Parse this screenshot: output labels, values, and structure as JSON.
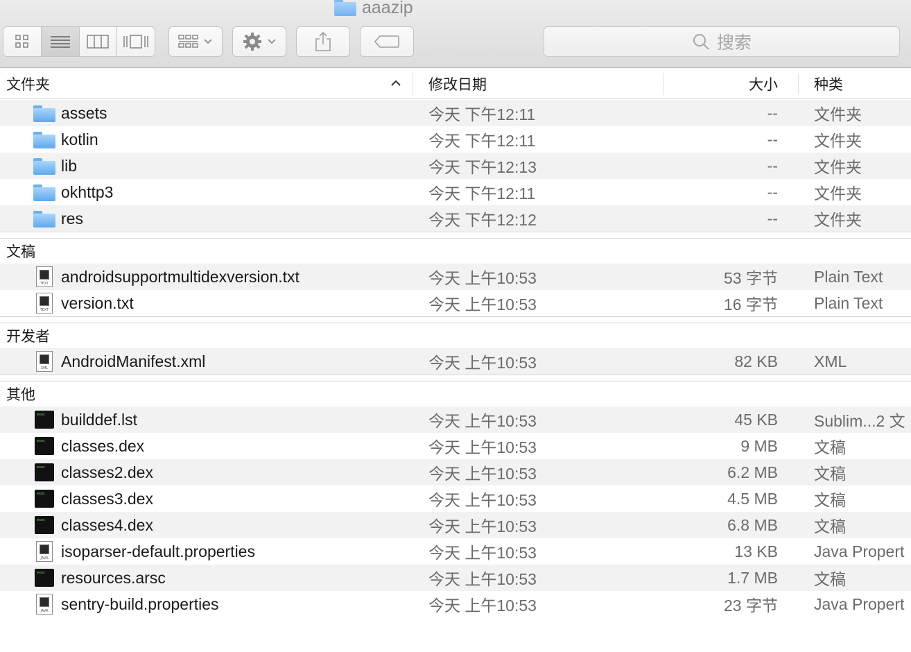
{
  "window": {
    "title": "aaazip"
  },
  "toolbar": {
    "view_buttons": [
      "icon-view",
      "list-view",
      "column-view",
      "cover-flow-view"
    ],
    "search_placeholder": "搜索"
  },
  "columns": {
    "name": "文件夹",
    "date": "修改日期",
    "size": "大小",
    "kind": "种类"
  },
  "folders": [
    {
      "name": "assets",
      "date": "今天 下午12:11",
      "size": "--",
      "kind": "文件夹"
    },
    {
      "name": "kotlin",
      "date": "今天 下午12:11",
      "size": "--",
      "kind": "文件夹"
    },
    {
      "name": "lib",
      "date": "今天 下午12:13",
      "size": "--",
      "kind": "文件夹"
    },
    {
      "name": "okhttp3",
      "date": "今天 下午12:11",
      "size": "--",
      "kind": "文件夹"
    },
    {
      "name": "res",
      "date": "今天 下午12:12",
      "size": "--",
      "kind": "文件夹"
    }
  ],
  "groups": [
    {
      "title": "文稿",
      "items": [
        {
          "name": "androidsupportmultidexversion.txt",
          "date": "今天 上午10:53",
          "size": "53 字节",
          "kind": "Plain Text",
          "icon": "TEXT"
        },
        {
          "name": "version.txt",
          "date": "今天 上午10:53",
          "size": "16 字节",
          "kind": "Plain Text",
          "icon": "TEXT"
        }
      ]
    },
    {
      "title": "开发者",
      "items": [
        {
          "name": "AndroidManifest.xml",
          "date": "今天 上午10:53",
          "size": "82 KB",
          "kind": "XML",
          "icon": "XML"
        }
      ]
    },
    {
      "title": "其他",
      "items": [
        {
          "name": "builddef.lst",
          "date": "今天 上午10:53",
          "size": "45 KB",
          "kind": "Sublim...2 文",
          "icon": "term"
        },
        {
          "name": "classes.dex",
          "date": "今天 上午10:53",
          "size": "9 MB",
          "kind": "文稿",
          "icon": "term"
        },
        {
          "name": "classes2.dex",
          "date": "今天 上午10:53",
          "size": "6.2 MB",
          "kind": "文稿",
          "icon": "term"
        },
        {
          "name": "classes3.dex",
          "date": "今天 上午10:53",
          "size": "4.5 MB",
          "kind": "文稿",
          "icon": "term"
        },
        {
          "name": "classes4.dex",
          "date": "今天 上午10:53",
          "size": "6.8 MB",
          "kind": "文稿",
          "icon": "term"
        },
        {
          "name": "isoparser-default.properties",
          "date": "今天 上午10:53",
          "size": "13 KB",
          "kind": "Java Propert",
          "icon": "JAVA"
        },
        {
          "name": "resources.arsc",
          "date": "今天 上午10:53",
          "size": "1.7 MB",
          "kind": "文稿",
          "icon": "term"
        },
        {
          "name": "sentry-build.properties",
          "date": "今天 上午10:53",
          "size": "23 字节",
          "kind": "Java Propert",
          "icon": "JAVA"
        }
      ]
    }
  ],
  "term_icon_text": "exec"
}
